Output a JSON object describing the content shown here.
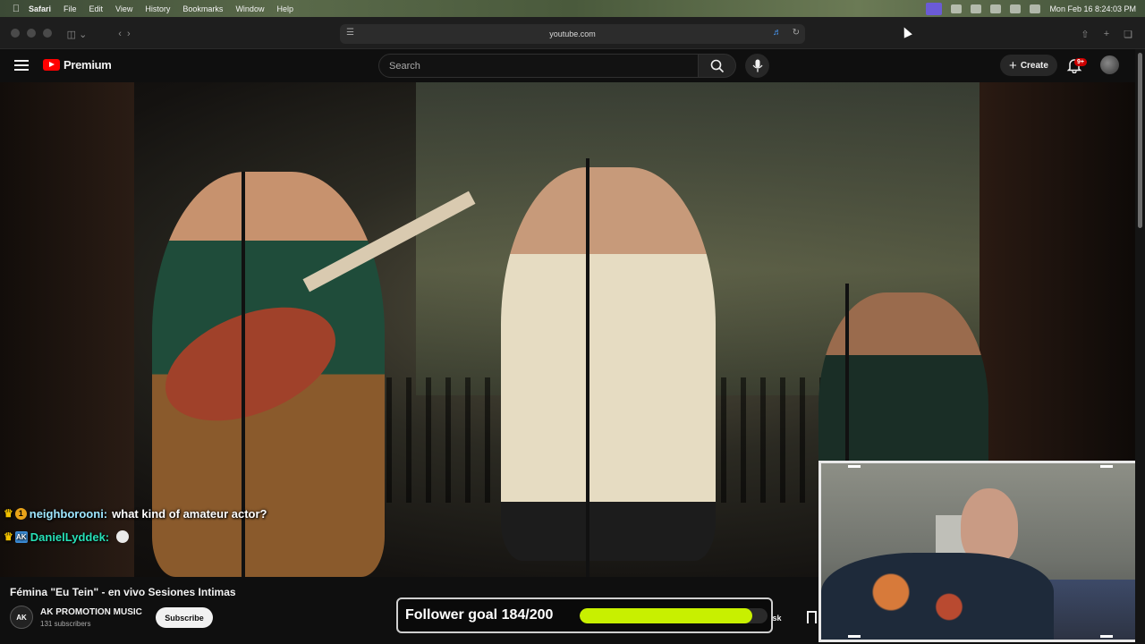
{
  "menubar": {
    "items": [
      "Safari",
      "File",
      "Edit",
      "View",
      "History",
      "Bookmarks",
      "Window",
      "Help"
    ],
    "datetime": "Mon Feb 16  8:24:03 PM"
  },
  "safari": {
    "url": "youtube.com"
  },
  "youtube": {
    "brand": "Premium",
    "search_placeholder": "Search",
    "create_label": "Create",
    "notification_count": "9+"
  },
  "video": {
    "title": "Fémina \"Eu Tein\" - en vivo Sesiones Intimas",
    "channel_avatar": "AK",
    "channel_name": "AK PROMOTION MUSIC",
    "subscribers": "131 subscribers",
    "subscribe_label": "Subscribe",
    "ask_label": "Ask"
  },
  "chat": [
    {
      "user": "neighborooni:",
      "message": "what kind of amateur actor?",
      "badge": "1"
    },
    {
      "user": "DanielLyddek:",
      "message": "",
      "badge": "AK"
    }
  ],
  "follower_goal": {
    "label": "Follower goal 184/200",
    "current": 184,
    "target": 200
  },
  "colors": {
    "yt_red": "#ff0000",
    "goal_fill": "#c8f000",
    "chat_name1": "#9ee6ff",
    "chat_name2": "#27e0b6"
  }
}
